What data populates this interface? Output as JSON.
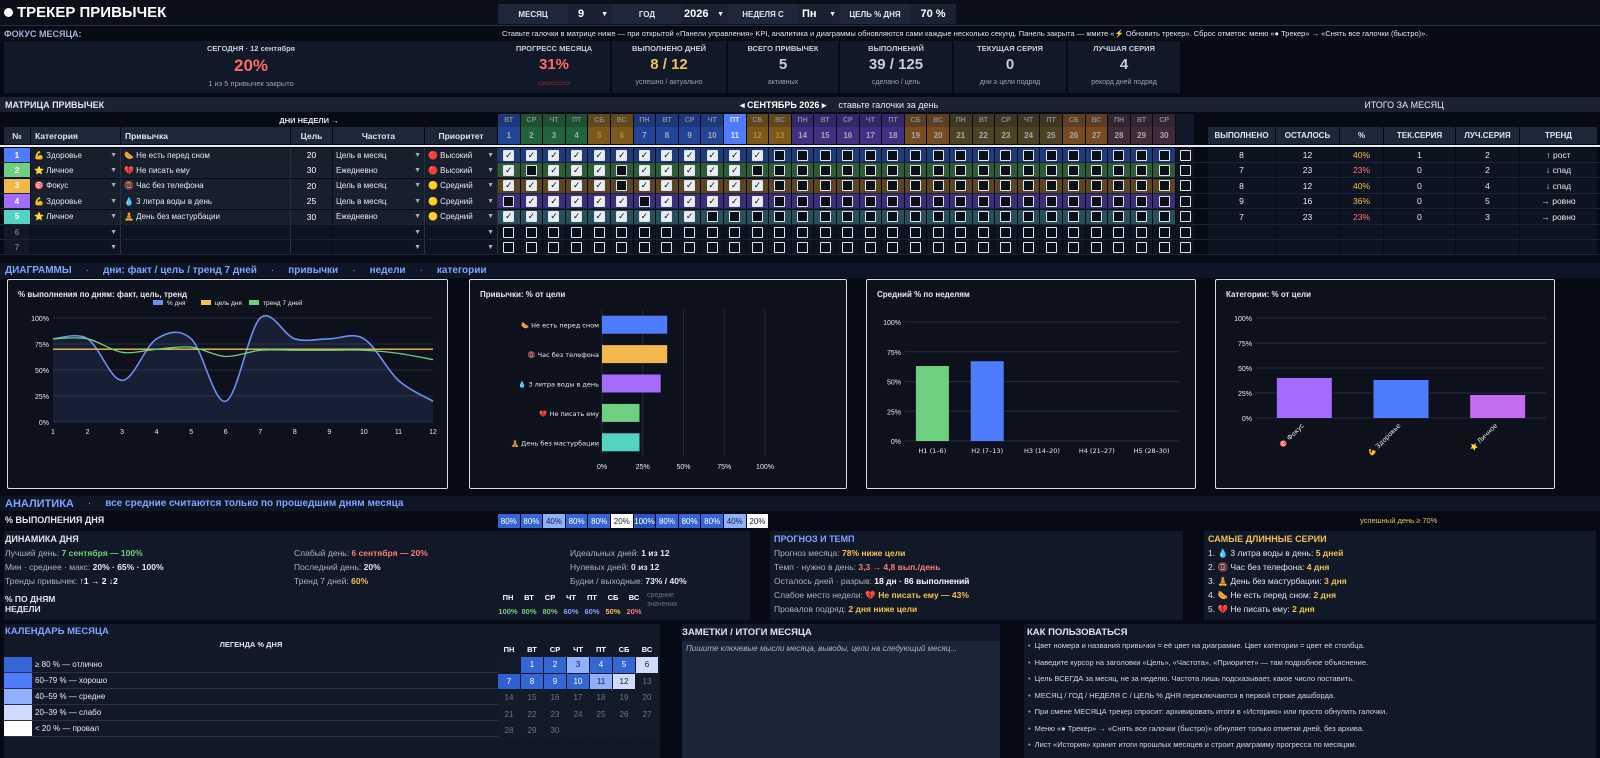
{
  "app": {
    "title": "ТРЕКЕР ПРИВЫЧЕК"
  },
  "controls": {
    "month_label": "МЕСЯЦ",
    "month_value": "9",
    "year_label": "ГОД",
    "year_value": "2026",
    "week_label": "НЕДЕЛЯ С",
    "week_value": "Пн",
    "goal_label": "ЦЕЛЬ % ДНЯ",
    "goal_value": "70 %"
  },
  "focus": {
    "label": "ФОКУС МЕСЯЦА:",
    "info": "Ставьте галочки в матрице ниже — при открытой «Панели управления» KPI, аналитика и диаграммы обновляются сами каждые несколько секунд. Панель закрыта — жмите «⚡ Обновить трекер». Сброс отметок: меню «● Трекер» → «Снять все галочки (быстро)».",
    "today_label": "СЕГОДНЯ · 12 сентября",
    "today_value": "20%",
    "today_sub": "1 из 5 привычек закрыто"
  },
  "kpis": [
    {
      "label": "ПРОГРЕСС МЕСЯЦА",
      "value": "31%",
      "sub": "▭▭▭▭▭",
      "color": "#ff6b6b"
    },
    {
      "label": "ВЫПОЛНЕНО ДНЕЙ",
      "value": "8 / 12",
      "sub": "успешно / актуально",
      "color": "#f2c14e"
    },
    {
      "label": "ВСЕГО ПРИВЫЧЕК",
      "value": "5",
      "sub": "активных",
      "color": "#c9ced8"
    },
    {
      "label": "ВЫПОЛНЕНИЙ",
      "value": "39 / 125",
      "sub": "сделано / цель",
      "color": "#c9ced8"
    },
    {
      "label": "ТЕКУЩАЯ СЕРИЯ",
      "value": "0",
      "sub": "дни ≥ цели подряд",
      "color": "#c9ced8"
    },
    {
      "label": "ЛУЧШАЯ СЕРИЯ",
      "value": "4",
      "sub": "рекорд дней подряд",
      "color": "#c9ced8"
    }
  ],
  "matrix": {
    "title": "МАТРИЦА ПРИВЫЧЕК",
    "weekdays_label": "ДНИ НЕДЕЛИ →",
    "month_nav": "◂ СЕНТЯБРЬ 2026  ▸",
    "month_hint": "ставьте галочки за день",
    "totals_title": "ИТОГО ЗА МЕСЯЦ",
    "col_headers": {
      "num": "№",
      "category": "Категория",
      "habit": "Привычка",
      "goal": "Цель",
      "freq": "Частота",
      "priority": "Приоритет"
    },
    "total_headers": [
      "ВЫПОЛНЕНО",
      "ОСТАЛОСЬ",
      "%",
      "ТЕК.СЕРИЯ",
      "ЛУЧ.СЕРИЯ",
      "ТРЕНД"
    ],
    "weekdays": [
      "ВТ",
      "СР",
      "ЧТ",
      "ПТ",
      "СБ",
      "ВС",
      "ПН",
      "ВТ",
      "СР",
      "ЧТ",
      "ПТ",
      "СБ",
      "ВС",
      "ПН",
      "ВТ",
      "СР",
      "ЧТ",
      "ПТ",
      "СБ",
      "ВС",
      "ПН",
      "ВТ",
      "СР",
      "ЧТ",
      "ПТ",
      "СБ",
      "ВС",
      "ПН",
      "ВТ",
      "СР"
    ],
    "days": [
      "1",
      "2",
      "3",
      "4",
      "5",
      "6",
      "7",
      "8",
      "9",
      "10",
      "11",
      "12",
      "13",
      "14",
      "15",
      "16",
      "17",
      "18",
      "19",
      "20",
      "21",
      "22",
      "23",
      "24",
      "25",
      "26",
      "27",
      "28",
      "29",
      "30"
    ],
    "rows": [
      {
        "num": "1",
        "category": "💪 Здоровье",
        "habit": "🌭 Не есть перед сном",
        "goal": "20",
        "freq": "Цель в месяц",
        "priority": "🔴 Высокий",
        "checks": "111111111111000000000000000000",
        "totals": [
          "8",
          "12",
          "40%",
          "1",
          "2",
          "↑ рост"
        ],
        "color": "#4f7cff"
      },
      {
        "num": "2",
        "category": "⭐ Личное",
        "habit": "💔 Не писать ему",
        "goal": "30",
        "freq": "Ежедневно",
        "priority": "🔴 Высокий",
        "checks": "101110111110000000000000000000",
        "totals": [
          "7",
          "23",
          "23%",
          "0",
          "2",
          "↓ спад"
        ],
        "color": "#6fcf80"
      },
      {
        "num": "3",
        "category": "🎯 Фокус",
        "habit": "📵 Час без телефона",
        "goal": "20",
        "freq": "Цель в месяц",
        "priority": "🟡 Средний",
        "checks": "111110111111000000000000000000",
        "totals": [
          "8",
          "12",
          "40%",
          "0",
          "4",
          "↓ спад"
        ],
        "color": "#f2b84b"
      },
      {
        "num": "4",
        "category": "💪 Здоровье",
        "habit": "💧 3 литра воды в день",
        "goal": "25",
        "freq": "Цель в месяц",
        "priority": "🟡 Средний",
        "checks": "011111011111000000000000000000",
        "totals": [
          "9",
          "16",
          "36%",
          "0",
          "5",
          "→ ровно"
        ],
        "color": "#a36cff"
      },
      {
        "num": "5",
        "category": "⭐ Личное",
        "habit": "🧘 День без мастурбации",
        "goal": "30",
        "freq": "Ежедневно",
        "priority": "🟡 Средний",
        "checks": "111111111000000000000000000000",
        "totals": [
          "7",
          "23",
          "23%",
          "0",
          "3",
          "→ ровно"
        ],
        "color": "#53d3c4"
      },
      {
        "num": "6",
        "category": "",
        "habit": "",
        "goal": "",
        "freq": "",
        "priority": "",
        "checks": "000000000000000000000000000000",
        "totals": [
          "",
          "",
          "",
          "",
          "",
          ""
        ],
        "color": ""
      },
      {
        "num": "7",
        "category": "",
        "habit": "",
        "goal": "",
        "freq": "",
        "priority": "",
        "checks": "000000000000000000000000000000",
        "totals": [
          "",
          "",
          "",
          "",
          "",
          ""
        ],
        "color": ""
      }
    ]
  },
  "diagrams": {
    "title": "ДИАГРАММЫ",
    "links": [
      "дни: факт / цель / тренд 7 дней",
      "привычки",
      "недели",
      "категории"
    ]
  },
  "chart_data": [
    {
      "type": "line",
      "title": "% выполнения по дням: факт, цель, тренд",
      "x": [
        1,
        2,
        3,
        4,
        5,
        6,
        7,
        8,
        9,
        10,
        11,
        12
      ],
      "ylim": [
        0,
        100
      ],
      "yticks": [
        "0%",
        "25%",
        "50%",
        "75%",
        "100%"
      ],
      "series": [
        {
          "name": "% дня",
          "color": "#6d8ff0",
          "values": [
            80,
            80,
            40,
            80,
            80,
            20,
            100,
            80,
            80,
            80,
            40,
            20
          ]
        },
        {
          "name": "цель дня",
          "color": "#f2c14e",
          "values": [
            70,
            70,
            70,
            70,
            70,
            70,
            70,
            70,
            70,
            70,
            70,
            70
          ]
        },
        {
          "name": "тренд 7 дней",
          "color": "#6fcf80",
          "values": [
            80,
            80,
            67,
            70,
            72,
            63,
            69,
            69,
            69,
            69,
            66,
            60
          ]
        }
      ]
    },
    {
      "type": "bar",
      "title": "Привычки: % от цели",
      "categories": [
        "🌭 Не есть перед сном",
        "📵 Час без телефона",
        "💧 3 литра воды в день",
        "💔 Не писать ему",
        "🧘 День без мастурбации"
      ],
      "values": [
        40,
        40,
        36,
        23,
        23
      ],
      "colors": [
        "#4f7cff",
        "#f2b84b",
        "#a36cff",
        "#6fcf80",
        "#53d3c4"
      ],
      "xticks": [
        "0%",
        "25%",
        "50%",
        "75%",
        "100%"
      ],
      "xlim": [
        0,
        100
      ]
    },
    {
      "type": "bar",
      "title": "Средний % по неделям",
      "categories": [
        "Н1 (1–6)",
        "Н2 (7–13)",
        "Н3 (14–20)",
        "Н4 (21–27)",
        "Н5 (28–30)"
      ],
      "values": [
        63,
        67,
        0,
        0,
        0
      ],
      "colors": [
        "#6fcf80",
        "#4f7cff",
        "#a36cff",
        "#f2b84b",
        "#53d3c4"
      ],
      "yticks": [
        "0%",
        "25%",
        "50%",
        "75%",
        "100%"
      ],
      "ylim": [
        0,
        100
      ]
    },
    {
      "type": "bar",
      "title": "Категории: % от цели",
      "categories": [
        "🎯 Фокус",
        "💪 Здоровье",
        "⭐ Личное"
      ],
      "values": [
        40,
        38,
        23
      ],
      "colors": [
        "#a36cff",
        "#4f7cff",
        "#c26cf0"
      ],
      "yticks": [
        "0%",
        "25%",
        "50%",
        "75%",
        "100%"
      ],
      "ylim": [
        0,
        100
      ]
    }
  ],
  "analytics": {
    "title": "АНАЛИТИКА",
    "subtitle": "все средние считаются только по прошедшим дням месяца",
    "daily_label": "% ВЫПОЛНЕНИЯ ДНЯ",
    "daily_values": [
      "80%",
      "80%",
      "40%",
      "80%",
      "80%",
      "20%",
      "100%",
      "80%",
      "80%",
      "80%",
      "40%",
      "20%"
    ],
    "success_note": "успешный день ≥ 70%",
    "dynamics_title": "ДИНАМИКА ДНЯ",
    "dynamics": [
      {
        "label": "Лучший день:",
        "value": "7 сентября — 100%",
        "color": "#6fcf80"
      },
      {
        "label": "Мин · среднее · макс:",
        "value": "20% · 65% · 100%",
        "color": "#e6e9ef"
      },
      {
        "label": "Тренды привычек:",
        "value": "↑1 → 2 ↓2",
        "color": "#ffffff"
      },
      {
        "label": "Слабый день:",
        "value": "6 сентября — 20%",
        "color": "#ff7b7b"
      },
      {
        "label": "Последний день:",
        "value": "20%",
        "color": "#e6e9ef"
      },
      {
        "label": "Тренд 7 дней:",
        "value": "60%",
        "color": "#f2c14e"
      },
      {
        "label": "Идеальных дней:",
        "value": "1 из 12",
        "color": "#e6e9ef"
      },
      {
        "label": "Нулевых дней:",
        "value": "0 из 12",
        "color": "#e6e9ef"
      },
      {
        "label": "Будни / выходные:",
        "value": "73% / 40%",
        "color": "#e6e9ef"
      }
    ],
    "weekday_title": "% ПО ДНЯМ НЕДЕЛИ",
    "weekday_headers": [
      "ПН",
      "ВТ",
      "СР",
      "ЧТ",
      "ПТ",
      "СБ",
      "ВС"
    ],
    "weekday_values": [
      "100%",
      "80%",
      "80%",
      "60%",
      "60%",
      "50%",
      "20%"
    ],
    "weekday_colors": [
      "#6fcf80",
      "#6fcf80",
      "#6fcf80",
      "#7ea4ff",
      "#7ea4ff",
      "#f2c14e",
      "#ff7b7b"
    ],
    "weekday_note": "средние\nзначения",
    "forecast_title": "ПРОГНОЗ И ТЕМП",
    "forecast": [
      {
        "label": "Прогноз месяца:",
        "value": "78%  ниже цели",
        "color": "#f2c14e"
      },
      {
        "label": "Темп · нужно в день:",
        "value": "3,3  →  4,8 вып./день",
        "color": "#ff7b7b"
      },
      {
        "label": "Осталось дней · разрыв:",
        "value": "18 дн  ·  86 выполнений",
        "color": "#ffffff"
      },
      {
        "label": "Слабое место недели:",
        "value": "💔 Не писать ему  — 43%",
        "color": "#f2c14e"
      },
      {
        "label": "Провалов подряд:",
        "value": "2 дня ниже цели",
        "color": "#f2c14e"
      }
    ],
    "streaks_title": "САМЫЕ ДЛИННЫЕ СЕРИИ",
    "streaks": [
      {
        "label": "1. 💧 3 литра воды в день:",
        "value": "5 дней"
      },
      {
        "label": "2. 📵 Час без телефона:",
        "value": "4 дня"
      },
      {
        "label": "3. 🧘 День без мастурбации:",
        "value": "3 дня"
      },
      {
        "label": "4. 🌭 Не есть перед сном:",
        "value": "2 дня"
      },
      {
        "label": "5. 💔 Не писать ему:",
        "value": "2 дня"
      }
    ]
  },
  "calendar": {
    "title": "КАЛЕНДАРЬ МЕСЯЦА",
    "legend_title": "ЛЕГЕНДА % ДНЯ",
    "legend": [
      {
        "color": "#3566d6",
        "text": "≥ 80 % — отлично"
      },
      {
        "color": "#4f7cff",
        "text": "60–79 % — хорошо"
      },
      {
        "color": "#8fb0ff",
        "text": "40–59 % — средне"
      },
      {
        "color": "#cfdcff",
        "text": "20–39 % — слабо"
      },
      {
        "color": "#ffffff",
        "text": "< 20 % — провал"
      }
    ],
    "weekdays": [
      "ПН",
      "ВТ",
      "СР",
      "ЧТ",
      "ПТ",
      "СБ",
      "ВС"
    ],
    "weeks": [
      [
        "",
        "1",
        "2",
        "3",
        "4",
        "5",
        "6"
      ],
      [
        "7",
        "8",
        "9",
        "10",
        "11",
        "12",
        "13"
      ],
      [
        "14",
        "15",
        "16",
        "17",
        "18",
        "19",
        "20"
      ],
      [
        "21",
        "22",
        "23",
        "24",
        "25",
        "26",
        "27"
      ],
      [
        "28",
        "29",
        "30",
        "",
        "",
        "",
        ""
      ]
    ],
    "day_pct": {
      "1": 80,
      "2": 80,
      "3": 40,
      "4": 80,
      "5": 80,
      "6": 20,
      "7": 100,
      "8": 80,
      "9": 80,
      "10": 80,
      "11": 40,
      "12": 20
    }
  },
  "notes": {
    "title": "ЗАМЕТКИ / ИТОГИ МЕСЯЦА",
    "placeholder": "Пишите ключевые мысли месяца, выводы, цели на следующий месяц..."
  },
  "howto": {
    "title": "КАК ПОЛЬЗОВАТЬСЯ",
    "items": [
      "Цвет номера и названия привычки = её цвет на диаграмме. Цвет категории = цвет её столбца.",
      "Наведите курсор на заголовки «Цель», «Частота», «Приоритет» — там подробное объяснение.",
      "Цель ВСЕГДА за месяц, не за неделю. Частота лишь подсказывает, какое число поставить.",
      "МЕСЯЦ / ГОД / НЕДЕЛЯ С / ЦЕЛЬ % ДНЯ переключаются в первой строке дашборда.",
      "При смене МЕСЯЦА трекер спросит: архивировать итоги в «Историю» или просто обнулить галочки.",
      "Меню «● Трекер» → «Снять все галочки (быстро)» обнуляет только отметки дней, без архива.",
      "Лист «История» хранит итоги прошлых месяцев и строит диаграмму прогресса по месяцам."
    ]
  }
}
